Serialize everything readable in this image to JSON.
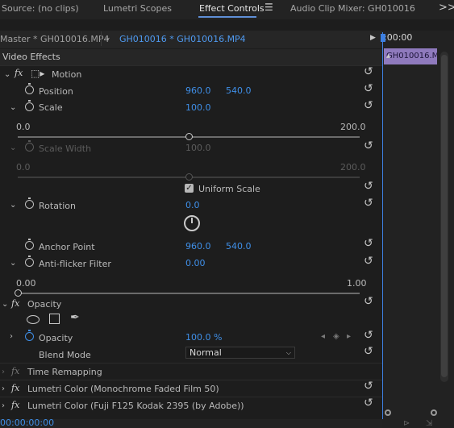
{
  "tabs": [
    {
      "label": "Source: (no clips)"
    },
    {
      "label": "Lumetri Scopes"
    },
    {
      "label": "Effect Controls"
    },
    {
      "label": "Audio Clip Mixer: GH010016"
    }
  ],
  "more_icon": ">>",
  "breadcrumb": {
    "master": "Master * GH010016.MP4",
    "clip": "GH010016 * GH010016.MP4"
  },
  "timeline": {
    "time_top": ":00:00",
    "clip_label": "GH010016.MP",
    "time_bottom": "00:00:00:00"
  },
  "section_title": "Video Effects",
  "motion": {
    "label": "Motion",
    "position": {
      "label": "Position",
      "x": "960.0",
      "y": "540.0"
    },
    "scale": {
      "label": "Scale",
      "value": "100.0",
      "min": "0.0",
      "max": "200.0",
      "level": 0.5
    },
    "scale_width": {
      "label": "Scale Width",
      "value": "100.0",
      "min": "0.0",
      "max": "200.0",
      "level": 0.5
    },
    "uniform_scale": {
      "label": "Uniform Scale",
      "checked": true
    },
    "rotation": {
      "label": "Rotation",
      "value": "0.0"
    },
    "anchor_point": {
      "label": "Anchor Point",
      "x": "960.0",
      "y": "540.0"
    },
    "anti_flicker": {
      "label": "Anti-flicker Filter",
      "value": "0.00",
      "min": "0.00",
      "max": "1.00",
      "level": 0.0
    }
  },
  "opacity": {
    "label": "Opacity",
    "opacity_param": {
      "label": "Opacity",
      "value": "100.0 %"
    },
    "blend_mode": {
      "label": "Blend Mode",
      "value": "Normal"
    }
  },
  "time_remapping": {
    "label": "Time Remapping"
  },
  "lumetri_1": {
    "label": "Lumetri Color (Monochrome Faded Film 50)"
  },
  "lumetri_2": {
    "label": "Lumetri Color (Fuji F125 Kodak 2395 (by Adobe))"
  },
  "colors": {
    "accent": "#3f8fe8",
    "clip": "#8f7abd",
    "playhead": "#3d7fe0"
  }
}
